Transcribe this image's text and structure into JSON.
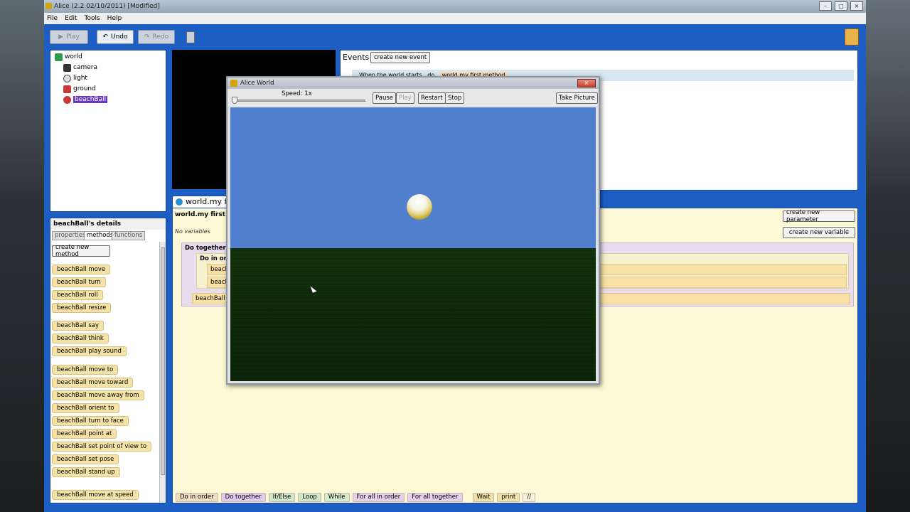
{
  "window": {
    "title": "Alice (2.2  02/10/2011)  [Modified]",
    "buttons": [
      "–",
      "□",
      "×"
    ]
  },
  "menu": [
    "File",
    "Edit",
    "Tools",
    "Help"
  ],
  "toolbar": {
    "play": "Play",
    "undo": "Undo",
    "redo": "Redo"
  },
  "tree": {
    "items": [
      {
        "label": "world",
        "icon": "world-icon"
      },
      {
        "label": "camera",
        "icon": "camera-icon"
      },
      {
        "label": "light",
        "icon": "light-icon"
      },
      {
        "label": "ground",
        "icon": "ground-icon"
      },
      {
        "label": "beachBall",
        "icon": "beachball-icon"
      }
    ]
  },
  "events": {
    "title": "Events",
    "create_button": "create new event",
    "row_prefix": "When the world starts , do",
    "row_method": "world.my first method"
  },
  "details": {
    "title": "beachBall's details",
    "tabs": [
      "properties",
      "methods",
      "functions"
    ],
    "create_method": "create new method",
    "methods": [
      "beachBall  move",
      "beachBall  turn",
      "beachBall  roll",
      "beachBall  resize",
      "beachBall  say",
      "beachBall  think",
      "beachBall  play sound",
      "beachBall  move to",
      "beachBall  move   toward",
      "beachBall  move    away from",
      "beachBall  orient to",
      "beachBall  turn to face",
      "beachBall  point at",
      "beachBall  set point of view to",
      "beachBall  set pose",
      "beachBall  stand up",
      "beachBall  move at speed"
    ]
  },
  "editor": {
    "tab": "world.my fir",
    "signature": "world.my first m",
    "no_vars": "No variables",
    "create_param": "create new parameter",
    "create_var": "create new variable",
    "do_together": "Do together",
    "do_in_order": "Do in ord",
    "stmt1": "beach",
    "stmt2": "beach",
    "stmt3": "beachBall"
  },
  "controls": [
    "Do in order",
    "Do together",
    "If/Else",
    "Loop",
    "While",
    "For all in order",
    "For all together",
    "Wait",
    "print",
    "//"
  ],
  "alice_world": {
    "title": "Alice World",
    "speed": "Speed: 1x",
    "speed_value": 0,
    "pause": "Pause",
    "play": "Play",
    "restart": "Restart",
    "stop": "Stop",
    "take_picture": "Take Picture",
    "close": "×"
  }
}
